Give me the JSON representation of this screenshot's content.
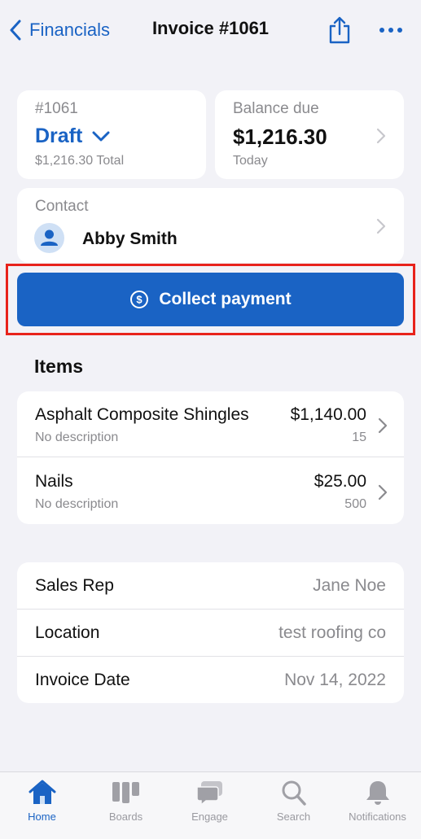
{
  "nav": {
    "back_label": "Financials",
    "title": "Invoice #1061",
    "share_icon": "share-icon",
    "more_icon": "more-icon"
  },
  "status_card": {
    "number": "#1061",
    "status": "Draft",
    "total": "$1,216.30 Total"
  },
  "balance_card": {
    "label": "Balance due",
    "amount": "$1,216.30",
    "due": "Today"
  },
  "contact": {
    "label": "Contact",
    "name": "Abby Smith"
  },
  "collect_button": {
    "label": "Collect payment",
    "icon": "dollar-circle-icon"
  },
  "items_section": {
    "title": "Items",
    "items": [
      {
        "name": "Asphalt Composite Shingles",
        "description": "No description",
        "price": "$1,140.00",
        "quantity": "15"
      },
      {
        "name": "Nails",
        "description": "No description",
        "price": "$25.00",
        "quantity": "500"
      }
    ]
  },
  "details": [
    {
      "label": "Sales Rep",
      "value": "Jane Noe"
    },
    {
      "label": "Location",
      "value": "test roofing co"
    },
    {
      "label": "Invoice Date",
      "value": "Nov 14, 2022"
    }
  ],
  "tabbar": {
    "tabs": [
      {
        "label": "Home",
        "icon": "home-icon",
        "active": true
      },
      {
        "label": "Boards",
        "icon": "boards-icon",
        "active": false
      },
      {
        "label": "Engage",
        "icon": "engage-icon",
        "active": false
      },
      {
        "label": "Search",
        "icon": "search-icon",
        "active": false
      },
      {
        "label": "Notifications",
        "icon": "bell-icon",
        "active": false
      }
    ]
  },
  "colors": {
    "accent": "#1a63c4",
    "background": "#f2f2f7",
    "highlight": "#e8231c",
    "muted": "#8a8a8e"
  }
}
